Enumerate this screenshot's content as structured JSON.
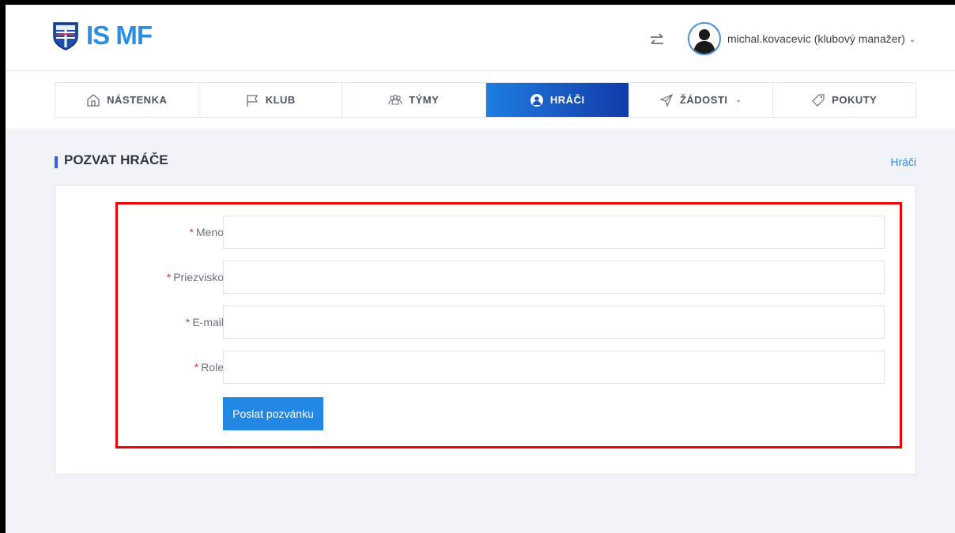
{
  "app": {
    "logo_text": "IS MF",
    "brand_color": "#2b8ee6"
  },
  "user": {
    "name": "michal.kovacevic (klubový manažer)",
    "chevron": "⌄"
  },
  "nav": {
    "items": [
      {
        "label": "NÁSTENKA",
        "icon": "home-icon"
      },
      {
        "label": "KLUB",
        "icon": "flag-icon"
      },
      {
        "label": "TÝMY",
        "icon": "team-icon"
      },
      {
        "label": "HRÁČI",
        "icon": "player-icon",
        "active": true
      },
      {
        "label": "ŽÁDOSTI",
        "icon": "send-icon",
        "has_dropdown": true,
        "chevron": "⌄"
      },
      {
        "label": "POKUTY",
        "icon": "tag-icon"
      }
    ]
  },
  "page": {
    "title": "POZVAT HRÁČE",
    "breadcrumb_link": "Hráči"
  },
  "form": {
    "required_mark": "*",
    "fields": [
      {
        "label": "Meno",
        "value": ""
      },
      {
        "label": "Priezvisko",
        "value": ""
      },
      {
        "label": "E-mail",
        "value": ""
      },
      {
        "label": "Role",
        "value": ""
      }
    ],
    "submit_label": "Poslat pozvánku"
  },
  "colors": {
    "active_nav_start": "#1e7ee0",
    "active_nav_end": "#123aa8",
    "button": "#2288e3",
    "highlight_border": "#ee0000",
    "required": "#e53946"
  }
}
